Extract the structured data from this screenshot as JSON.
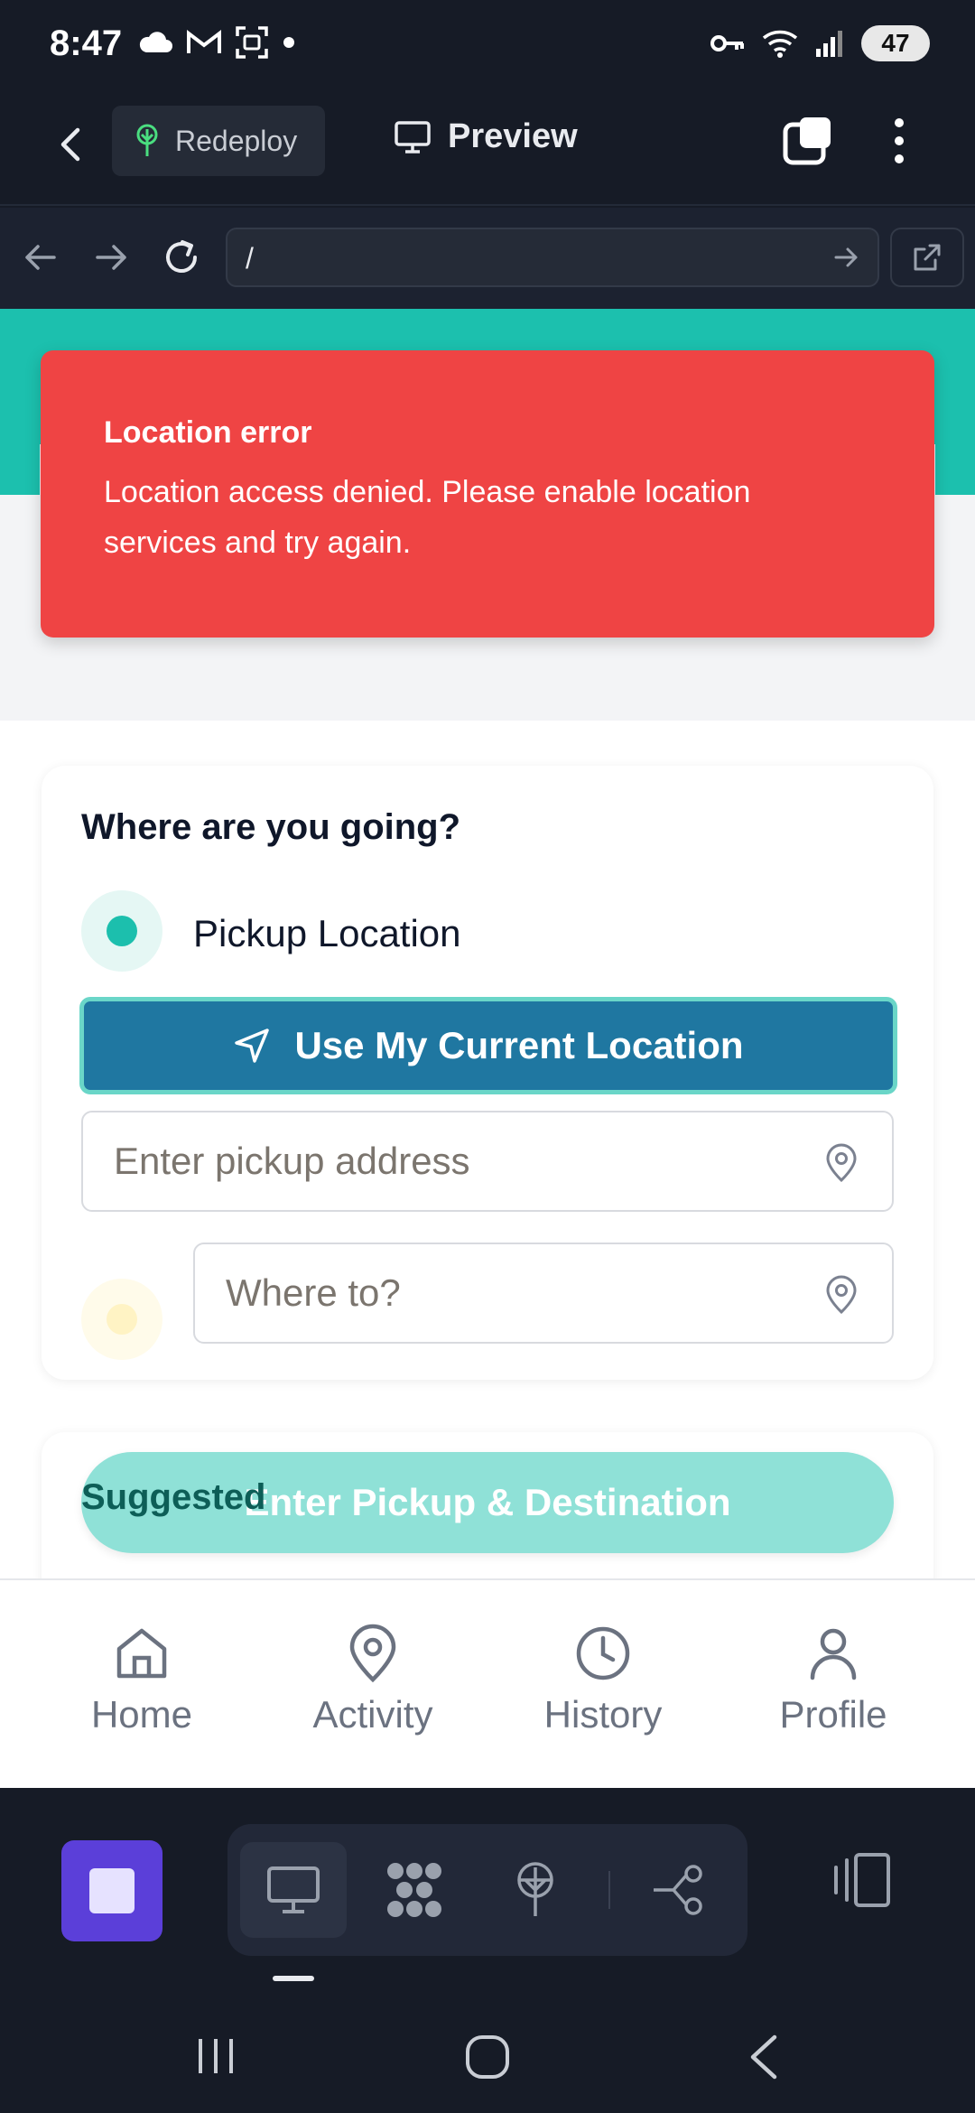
{
  "status_bar": {
    "time": "8:47",
    "battery": "47",
    "left_icons": [
      "cloud-icon",
      "gmail-icon",
      "screenshot-icon",
      "dot-icon"
    ],
    "right_icons": [
      "key-icon",
      "wifi-icon",
      "signal-icon",
      "battery-icon"
    ]
  },
  "toolbar": {
    "redeploy_label": "Redeploy",
    "preview_label": "Preview"
  },
  "browser": {
    "url": "/"
  },
  "toast": {
    "title": "Location error",
    "message": "Location access denied. Please enable location services and try again."
  },
  "trip_card": {
    "title": "Where are you going?",
    "pickup_label": "Pickup Location",
    "use_location_label": "Use My Current Location",
    "pickup_placeholder": "Enter pickup address",
    "destination_placeholder": "Where to?"
  },
  "suggested": {
    "heading": "Suggested",
    "submit_label": "Enter Pickup & Destination"
  },
  "bottom_nav": {
    "items": [
      {
        "label": "Home",
        "icon": "home-icon"
      },
      {
        "label": "Activity",
        "icon": "map-pin-icon"
      },
      {
        "label": "History",
        "icon": "clock-icon"
      },
      {
        "label": "Profile",
        "icon": "user-icon"
      }
    ]
  },
  "colors": {
    "teal": "#1cc0ae",
    "error_red": "#ef4444",
    "primary_blue": "#1f77a1",
    "dock_purple": "#5b3fd9"
  }
}
